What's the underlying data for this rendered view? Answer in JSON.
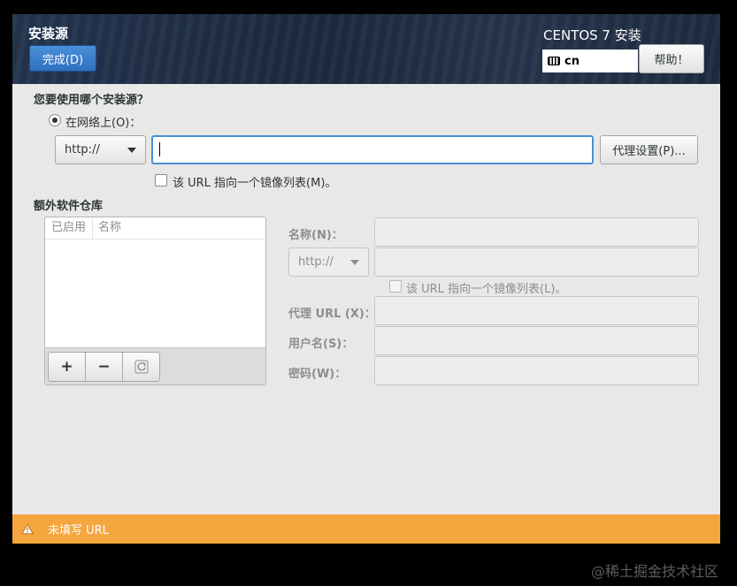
{
  "header": {
    "spoke_title": "安装源",
    "done_label": "完成(D)",
    "product_title": "CENTOS 7 安装",
    "keyboard_layout": "cn",
    "help_label": "帮助！"
  },
  "source": {
    "question": "您要使用哪个安装源？",
    "network_option_label": "在网络上(O)：",
    "protocol_selected": "http://",
    "url_value": "",
    "proxy_button_label": "代理设置(P)...",
    "mirror_checkbox_label": "该 URL 指向一个镜像列表(M)。"
  },
  "repos": {
    "heading": "额外软件仓库",
    "columns": [
      "已启用",
      "名称"
    ],
    "add_label": "+",
    "remove_label": "−",
    "refresh_icon": "refresh-icon"
  },
  "repo_form": {
    "name_label": "名称(N)：",
    "protocol_selected": "http://",
    "mirror_checkbox_label": "该 URL 指向一个镜像列表(L)。",
    "proxy_url_label": "代理 URL (X)：",
    "username_label": "用户名(S)：",
    "password_label": "密码(W)："
  },
  "warning": {
    "text": "未填写 URL",
    "icon": "warning-icon",
    "color": "#f5a63e"
  },
  "watermark": "@稀土掘金技术社区"
}
